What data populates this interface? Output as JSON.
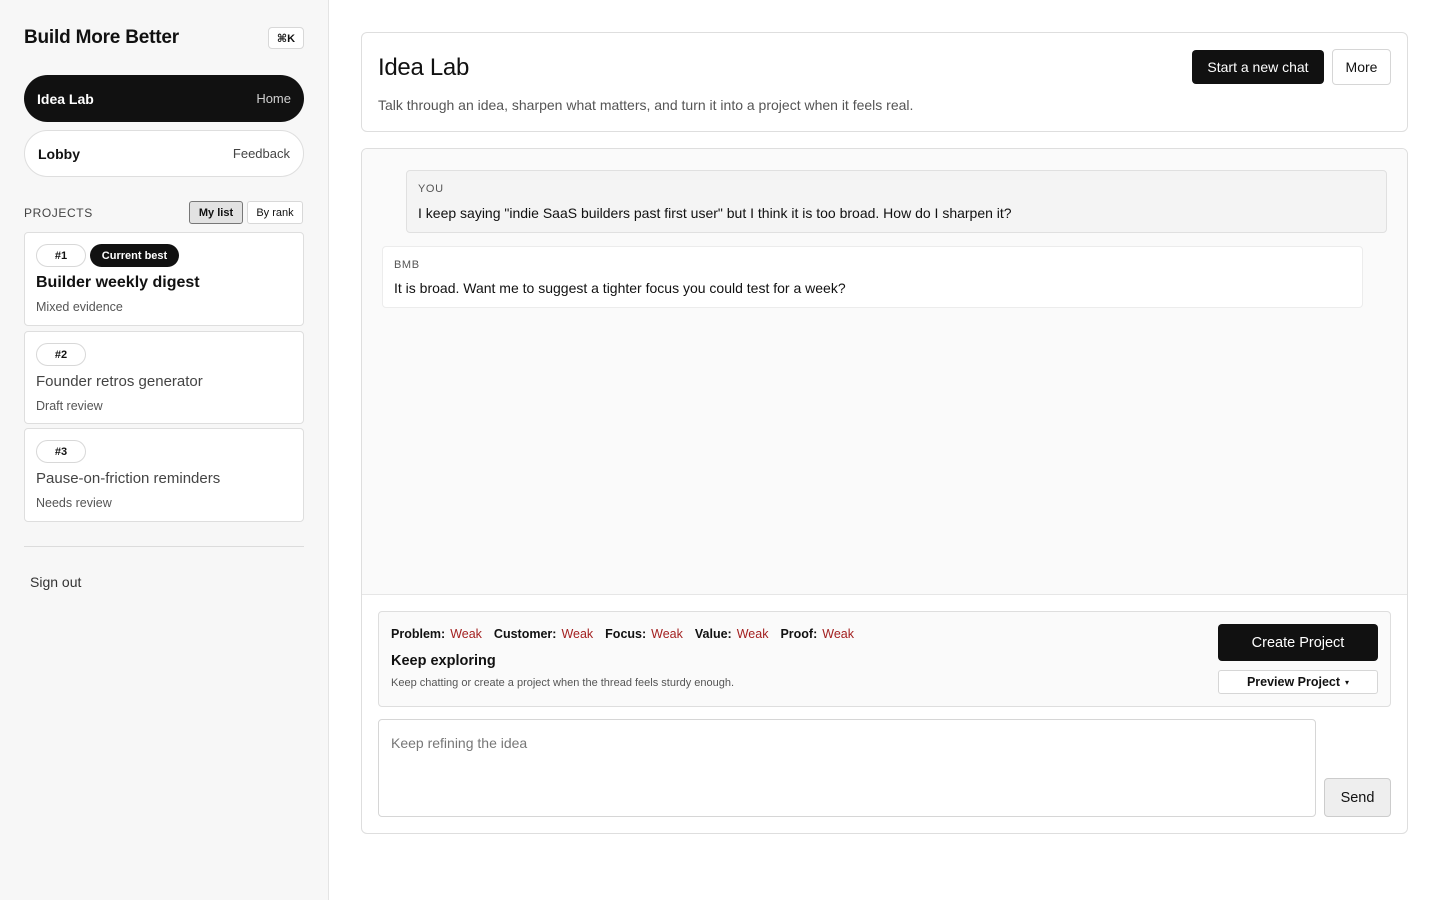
{
  "sidebar": {
    "brand": "Build More Better",
    "shortcut": "⌘K",
    "nav": [
      {
        "label": "Idea Lab",
        "hint": "Home",
        "active": true
      },
      {
        "label": "Lobby",
        "hint": "Feedback",
        "active": false
      }
    ],
    "projects_heading": "PROJECTS",
    "sort_options": [
      {
        "label": "My list",
        "selected": true
      },
      {
        "label": "By rank",
        "selected": false
      }
    ],
    "projects": [
      {
        "rank": "#1",
        "badge": "Current best",
        "title": "Builder weekly digest",
        "status": "Mixed evidence"
      },
      {
        "rank": "#2",
        "title": "Founder retros generator",
        "status": "Draft review"
      },
      {
        "rank": "#3",
        "title": "Pause-on-friction reminders",
        "status": "Needs review"
      }
    ],
    "sign_out": "Sign out"
  },
  "header": {
    "title": "Idea Lab",
    "subtitle": "Talk through an idea, sharpen what matters, and turn it into a project when it feels real.",
    "new_chat_label": "Start a new chat",
    "more_label": "More"
  },
  "chat": {
    "messages": [
      {
        "author": "YOU",
        "text": "I keep saying \"indie SaaS builders past first user\" but I think it is too broad. How do I sharpen it?"
      },
      {
        "author": "BMB",
        "text": "It is broad. Want me to suggest a tighter focus you could test for a week?"
      }
    ]
  },
  "assessment": {
    "metrics": [
      {
        "label": "Problem:",
        "value": "Weak"
      },
      {
        "label": "Customer:",
        "value": "Weak"
      },
      {
        "label": "Focus:",
        "value": "Weak"
      },
      {
        "label": "Value:",
        "value": "Weak"
      },
      {
        "label": "Proof:",
        "value": "Weak"
      }
    ],
    "verdict": "Keep exploring",
    "verdict_sub": "Keep chatting or create a project when the thread feels sturdy enough.",
    "create_label": "Create Project",
    "preview_label": "Preview Project",
    "preview_caret": "▾",
    "weak_color": "#a32020"
  },
  "composer": {
    "placeholder": "Keep refining the idea",
    "value": "",
    "send_label": "Send"
  }
}
